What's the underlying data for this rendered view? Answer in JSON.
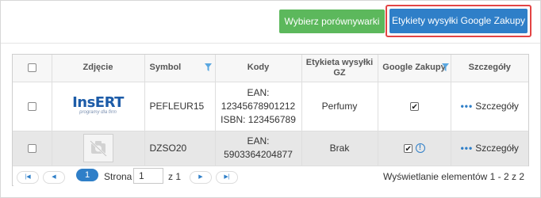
{
  "toolbar": {
    "compare_button": "Wybierz porównywarki",
    "google_labels_button": "Etykiety wysyłki Google Zakupy"
  },
  "table": {
    "headers": {
      "photo": "Zdjęcie",
      "symbol": "Symbol",
      "codes": "Kody",
      "shipping_label_line1": "Etykieta wysyłki",
      "shipping_label_line2": "GZ",
      "google_shopping": "Google Zakupy",
      "details": "Szczegóły"
    },
    "rows": [
      {
        "logo_text": "InsERT",
        "logo_sub": "programy dla firm",
        "symbol": "PEFLEUR15",
        "codes": [
          "EAN:",
          "12345678901212",
          "ISBN: 123456789"
        ],
        "shipping_label": "Perfumy",
        "google_checked": true,
        "details": "Szczegóły"
      },
      {
        "symbol": "DZSO20",
        "codes": [
          "EAN:",
          "5903364204877"
        ],
        "shipping_label": "Brak",
        "google_checked": true,
        "google_warning": "!",
        "details": "Szczegóły"
      }
    ]
  },
  "pager": {
    "current_page": "1",
    "page_label": "Strona",
    "page_input": "1",
    "of_label": "z 1",
    "status": "Wyświetlanie elementów 1 - 2 z 2"
  },
  "colors": {
    "green_button": "#5cb85c",
    "blue_button": "#2f7fc8",
    "highlight_border": "#e34444"
  }
}
